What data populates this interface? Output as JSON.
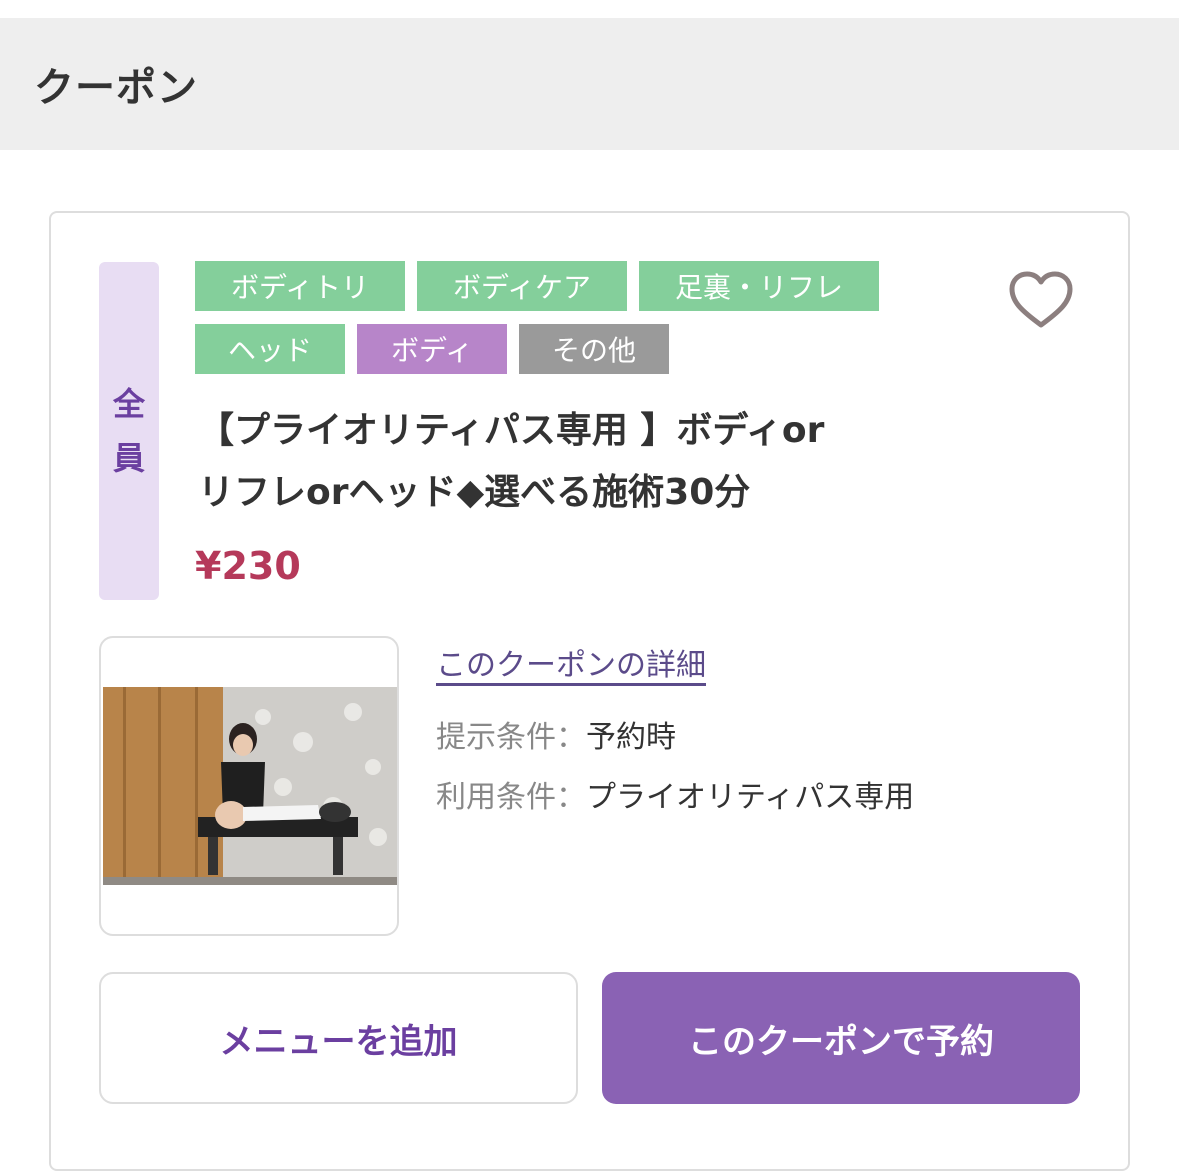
{
  "header": {
    "title": "クーポン"
  },
  "coupon": {
    "target": [
      "全",
      "員"
    ],
    "tags": [
      {
        "label": "ボディトリ",
        "color": "#84cf9b"
      },
      {
        "label": "ボディケア",
        "color": "#84cf9b"
      },
      {
        "label": "足裏・リフレ",
        "color": "#84cf9b"
      },
      {
        "label": "ヘッド",
        "color": "#84cf9b"
      },
      {
        "label": "ボディ",
        "color": "#b785c9"
      },
      {
        "label": "その他",
        "color": "#9a9a9a"
      }
    ],
    "title_lines": [
      "【プライオリティパス専用 】ボディor",
      "リフレorヘッド◆選べる施術30分"
    ],
    "price": "¥230",
    "detail_link": "このクーポンの詳細",
    "conditions": [
      {
        "label": "提示条件：",
        "value": "予約時"
      },
      {
        "label": "利用条件：",
        "value": "プライオリティパス専用"
      }
    ],
    "favorite_icon": "heart-outline-icon",
    "image": "massage-photo"
  },
  "actions": {
    "add_menu": "メニューを追加",
    "reserve": "このクーポンで予約"
  },
  "colors": {
    "accent_purple": "#8a62b4",
    "price_red": "#b5395a",
    "tag_green": "#84cf9b",
    "tag_purple": "#b785c9",
    "tag_gray": "#9a9a9a",
    "badge_bg": "#e8ddf3"
  }
}
